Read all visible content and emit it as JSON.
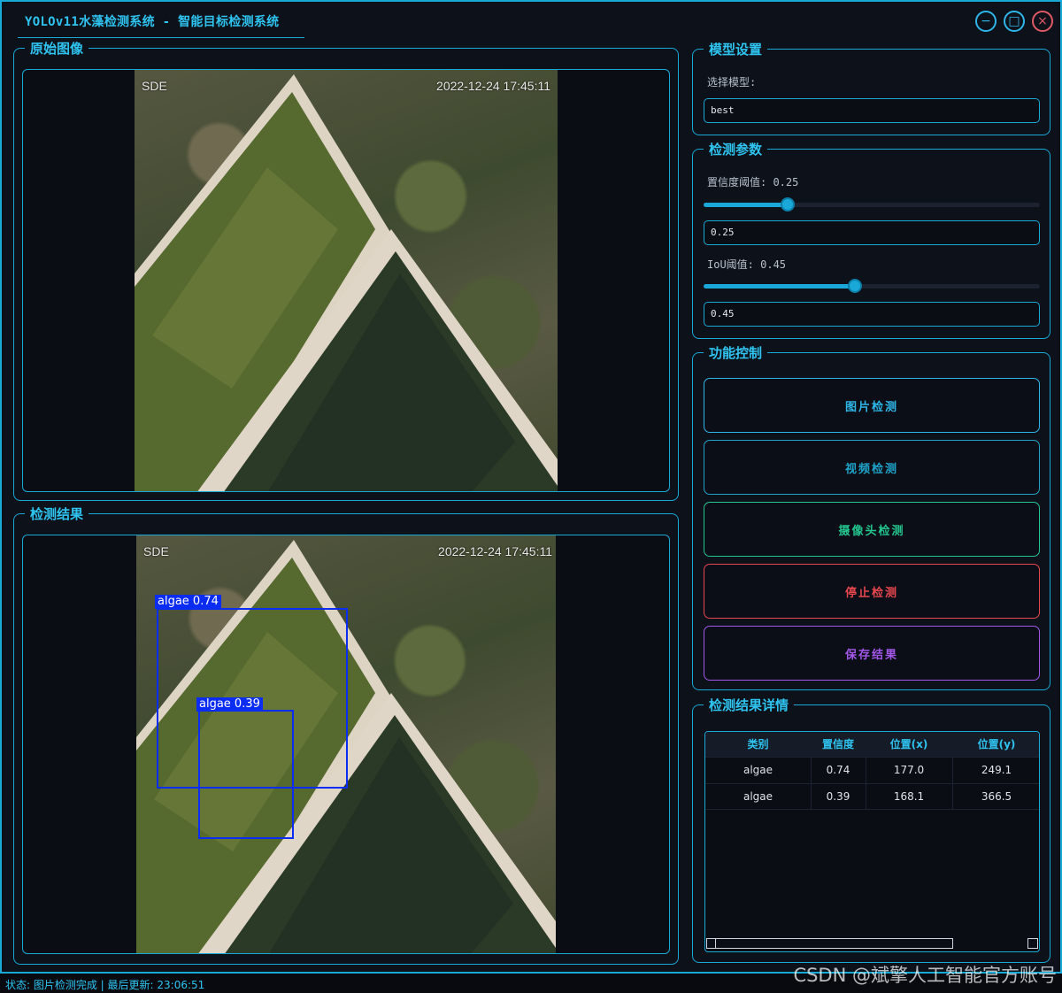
{
  "window": {
    "title": "YOLOv11水藻检测系统 - 智能目标检测系统",
    "controls": {
      "minimize": "−",
      "maximize": "□",
      "close": "×"
    }
  },
  "original_panel": {
    "title": "原始图像",
    "image": {
      "brand_text": "SDE",
      "timestamp_text": "2022-12-24 17:45:11"
    }
  },
  "result_panel": {
    "title": "检测结果",
    "image": {
      "brand_text": "SDE",
      "timestamp_text": "2022-12-24 17:45:11"
    },
    "detections": [
      {
        "label": "algae 0.74"
      },
      {
        "label": "algae 0.39"
      }
    ]
  },
  "model_settings": {
    "title": "模型设置",
    "select_label": "选择模型:",
    "selected_model": "best"
  },
  "detection_params": {
    "title": "检测参数",
    "confidence": {
      "label": "置信度阈值: 0.25",
      "value": 0.25,
      "input_value": "0.25"
    },
    "iou": {
      "label": "IoU阈值: 0.45",
      "value": 0.45,
      "input_value": "0.45"
    }
  },
  "function_control": {
    "title": "功能控制",
    "buttons": [
      {
        "label": "图片检测",
        "color": "#2fb6e8"
      },
      {
        "label": "视频检测",
        "color": "#1fa3c9"
      },
      {
        "label": "摄像头检测",
        "color": "#24c48e"
      },
      {
        "label": "停止检测",
        "color": "#e8474f"
      },
      {
        "label": "保存结果",
        "color": "#a257e8"
      }
    ]
  },
  "results_detail": {
    "title": "检测结果详情",
    "columns": [
      "类别",
      "置信度",
      "位置(x)",
      "位置(y)"
    ],
    "rows": [
      [
        "algae",
        "0.74",
        "177.0",
        "249.1"
      ],
      [
        "algae",
        "0.39",
        "168.1",
        "366.5"
      ]
    ]
  },
  "status_bar": {
    "text": "状态: 图片检测完成 | 最后更新: 23:06:51"
  },
  "watermark": "CSDN @斌擎人工智能官方账号",
  "colors": {
    "accent": "#18a9d6",
    "title_text": "#2fc4f0",
    "bbox": "#0b2cf3"
  }
}
